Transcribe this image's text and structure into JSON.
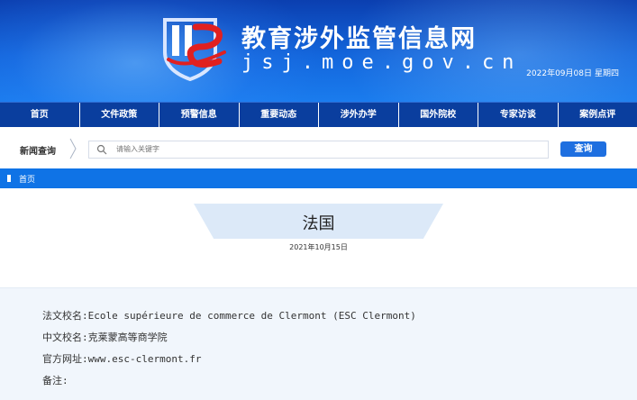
{
  "header": {
    "site_title": "教育涉外监管信息网",
    "site_domain": "jsj.moe.gov.cn",
    "date": "2022年09月08日",
    "weekday": "星期四",
    "logo_text": "JSJ"
  },
  "nav": {
    "items": [
      "首页",
      "文件政策",
      "预警信息",
      "重要动态",
      "涉外办学",
      "国外院校",
      "专家访谈",
      "案例点评"
    ]
  },
  "search": {
    "label": "新闻查询",
    "placeholder": "请输入关键字",
    "button_label": "查询"
  },
  "breadcrumb": {
    "home": "首页"
  },
  "article": {
    "title": "法国",
    "date": "2021年10月15日",
    "fields": [
      {
        "label": "法文校名:",
        "value": "Ecole supérieure de commerce de Clermont (ESC Clermont)"
      },
      {
        "label": "中文校名:",
        "value": "克莱蒙高等商学院"
      },
      {
        "label": "官方网址:",
        "value": "www.esc-clermont.fr"
      },
      {
        "label": "备注:",
        "value": ""
      }
    ]
  },
  "colors": {
    "header_blue": "#1366dc",
    "nav_blue": "#0a3e9e",
    "accent": "#1e6fe0",
    "logo_red": "#e02020"
  }
}
